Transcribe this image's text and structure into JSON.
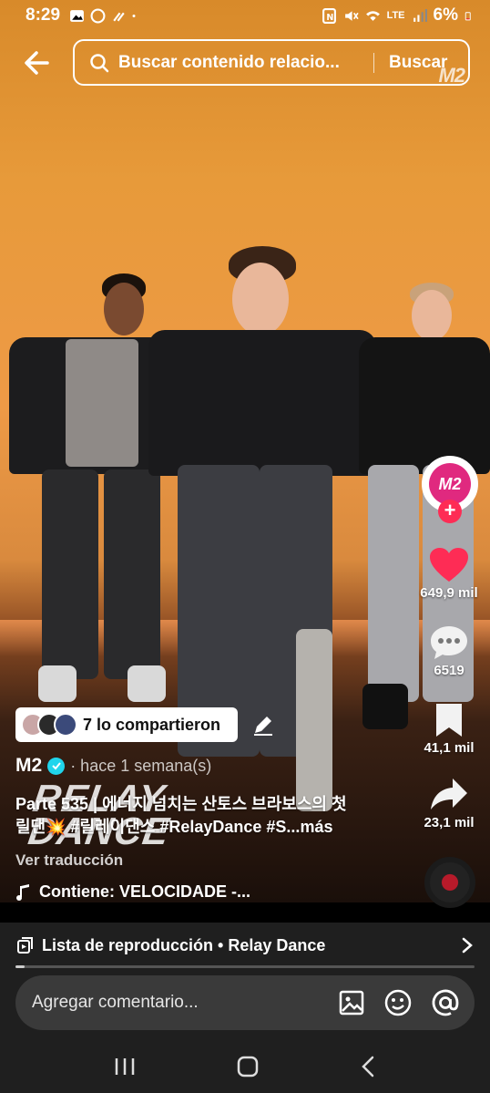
{
  "status_bar": {
    "time": "8:29",
    "battery": "6%",
    "network": "LTE"
  },
  "search": {
    "placeholder": "Buscar contenido relacio...",
    "button_label": "Buscar"
  },
  "watermark": "M2",
  "video_logo": {
    "line1": "RELAY",
    "line2": "DANCE"
  },
  "rail": {
    "avatar_text": "M2",
    "likes": "649,9 mil",
    "comments": "6519",
    "saves": "41,1 mil",
    "shares": "23,1 mil"
  },
  "shared": {
    "label": "7 lo compartieron"
  },
  "author": {
    "name": "M2",
    "posted": "· hace 1 semana(s)"
  },
  "caption": {
    "line1": "Parte 535 | 에너지 넘치는 산토스 브라보스의 첫",
    "line2": "릴댄💥 #릴레이댄스 #RelayDance #S...",
    "more": "más",
    "translate": "Ver traducción"
  },
  "music": {
    "label": "Contiene: VELOCIDADE -..."
  },
  "playlist": {
    "label": "Lista de reproducción • Relay Dance",
    "progress": 0.02
  },
  "comment": {
    "placeholder": "Agregar comentario..."
  },
  "colors": {
    "like": "#fe2c55",
    "verified": "#20d5ec",
    "brand": "#e0297f"
  }
}
